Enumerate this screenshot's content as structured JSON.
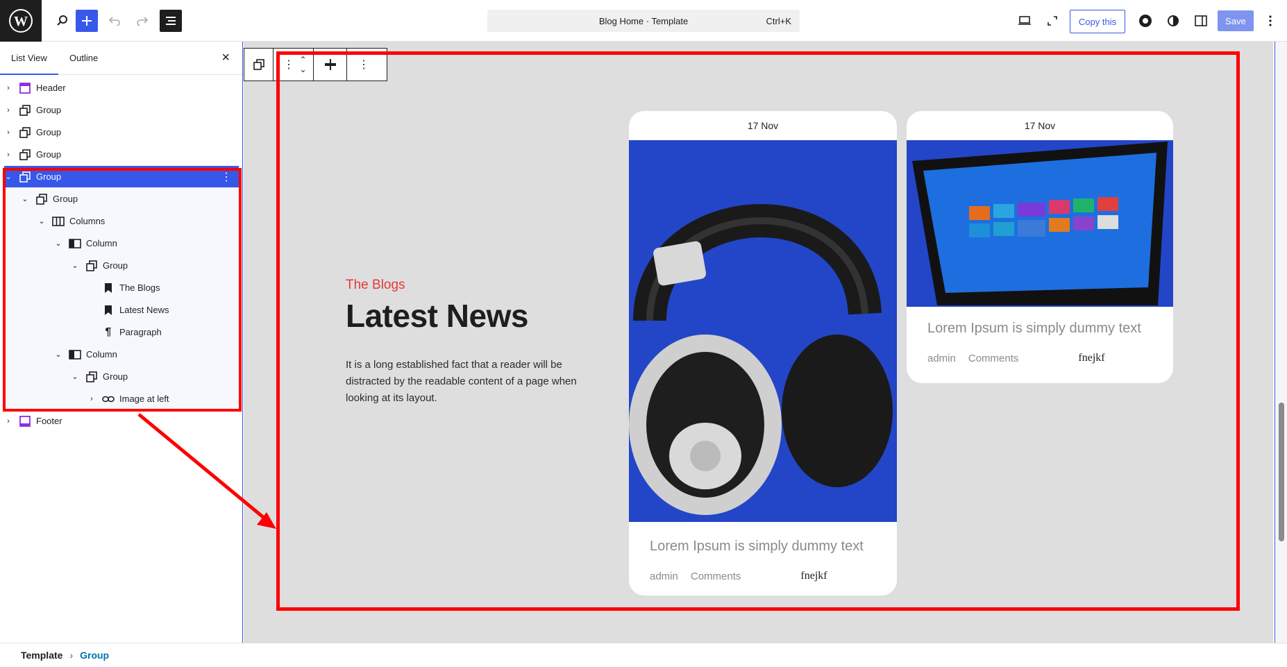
{
  "topbar": {
    "command_title": "Blog Home · Template",
    "command_shortcut": "Ctrl+K",
    "copy_label": "Copy this",
    "save_label": "Save"
  },
  "sidebar": {
    "tabs": [
      {
        "label": "List View"
      },
      {
        "label": "Outline"
      }
    ],
    "tree": [
      {
        "label": "Header"
      },
      {
        "label": "Group"
      },
      {
        "label": "Group"
      },
      {
        "label": "Group"
      },
      {
        "label": "Group"
      },
      {
        "label": "Group"
      },
      {
        "label": "Columns"
      },
      {
        "label": "Column"
      },
      {
        "label": "Group"
      },
      {
        "label": "The Blogs"
      },
      {
        "label": "Latest News"
      },
      {
        "label": "Paragraph"
      },
      {
        "label": "Column"
      },
      {
        "label": "Group"
      },
      {
        "label": "Image at left"
      },
      {
        "label": "Footer"
      }
    ]
  },
  "content": {
    "eyebrow": "The Blogs",
    "headline": "Latest News",
    "paragraph": "It is a long established fact that a reader will be  distracted by the readable content of a page when looking at its layout.",
    "cards": [
      {
        "date": "17 Nov",
        "title": "Lorem Ipsum is simply dummy text",
        "author": "admin",
        "comments": "Comments",
        "tag": "fnejkf"
      },
      {
        "date": "17 Nov",
        "title": "Lorem Ipsum is simply dummy text",
        "author": "admin",
        "comments": "Comments",
        "tag": "fnejkf"
      }
    ]
  },
  "breadcrumb": {
    "root": "Template",
    "current": "Group"
  },
  "colors": {
    "accent": "#3858e9",
    "highlight": "#ff0000",
    "eyebrow": "#e53935",
    "card_image_bg": "#2346c8"
  }
}
